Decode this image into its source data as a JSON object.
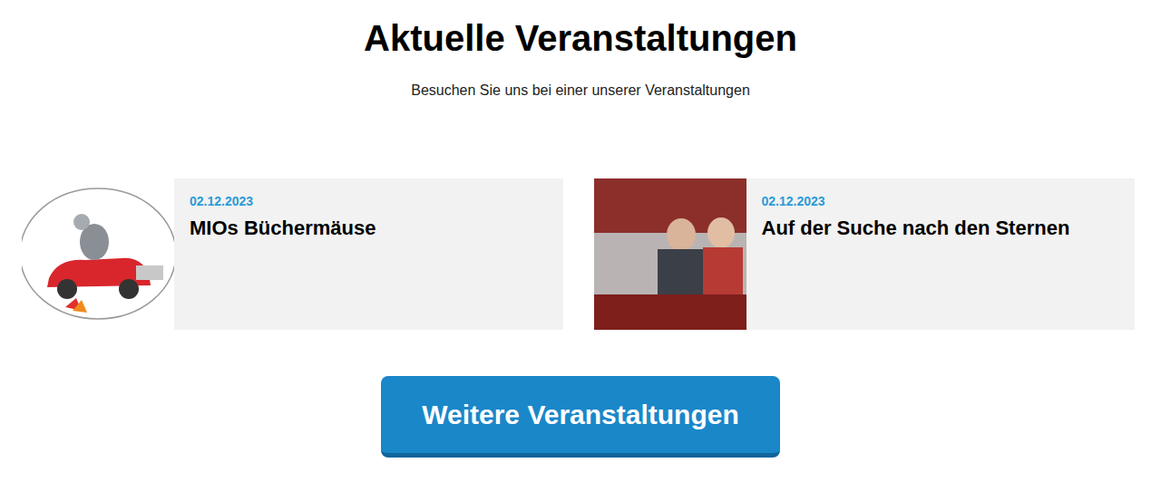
{
  "heading": "Aktuelle Veranstaltungen",
  "subtitle": "Besuchen Sie uns bei einer unserer Veranstaltungen",
  "events": [
    {
      "date": "02.12.2023",
      "title": "MIOs Büchermäuse"
    },
    {
      "date": "02.12.2023",
      "title": "Auf der Suche nach den Sternen"
    }
  ],
  "button": "Weitere Veranstaltungen"
}
